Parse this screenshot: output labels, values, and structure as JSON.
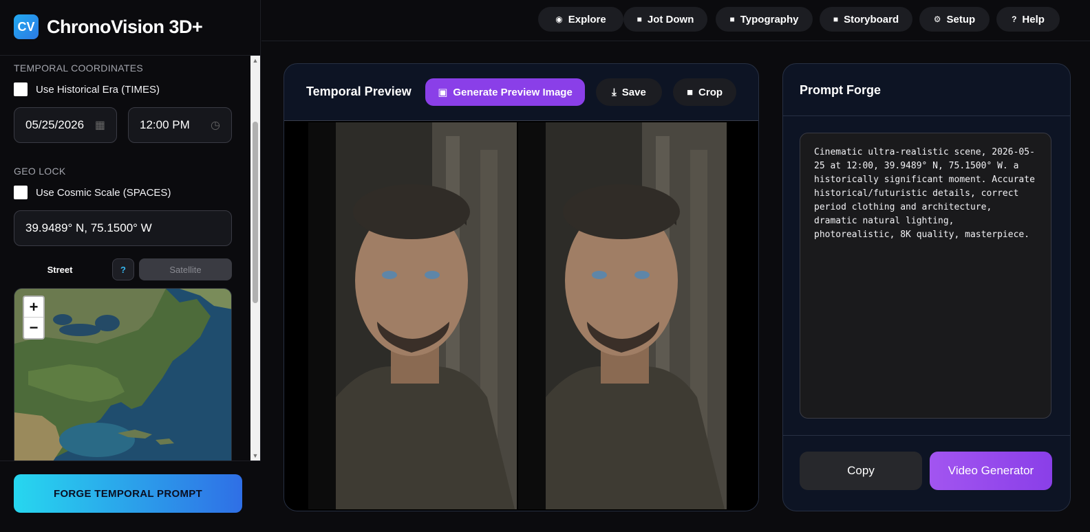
{
  "brand": {
    "logo_text": "CV",
    "title": "ChronoVision 3D+"
  },
  "nav": [
    {
      "label": "Explore",
      "icon": "compass-icon"
    },
    {
      "label": "Jot Down",
      "icon": "note-icon"
    },
    {
      "label": "Typography",
      "icon": "note-icon"
    },
    {
      "label": "Storyboard",
      "icon": "note-icon"
    },
    {
      "label": "Setup",
      "icon": "gear-icon"
    },
    {
      "label": "Help",
      "icon": "question-icon"
    }
  ],
  "sidebar": {
    "temporal_label": "TEMPORAL COORDINATES",
    "historical_era_label": "Use Historical Era (TIMES)",
    "date_value": "05/25/2026",
    "time_value": "12:00 PM",
    "geo_label": "GEO LOCK",
    "cosmic_scale_label": "Use Cosmic Scale (SPACES)",
    "coords_value": "39.9489° N, 75.1500° W",
    "map_street": "Street",
    "map_help": "?",
    "map_satellite": "Satellite",
    "zoom_in": "+",
    "zoom_out": "−",
    "forge_button": "FORGE TEMPORAL PROMPT"
  },
  "preview": {
    "title": "Temporal Preview",
    "generate_label": "Generate Preview Image",
    "save_label": "Save",
    "crop_label": "Crop"
  },
  "forge": {
    "title": "Prompt Forge",
    "prompt_text": "Cinematic ultra-realistic scene, 2026-05-25 at 12:00, 39.9489° N, 75.1500° W. a historically significant moment. Accurate historical/futuristic details, correct period clothing and architecture, dramatic natural lighting, photorealistic, 8K quality, masterpiece.",
    "copy_label": "Copy",
    "video_label": "Video Generator"
  },
  "colors": {
    "accent_purple": "#8a3fe8",
    "accent_cyan": "#27d7ef",
    "panel_bg": "#0d1424"
  }
}
